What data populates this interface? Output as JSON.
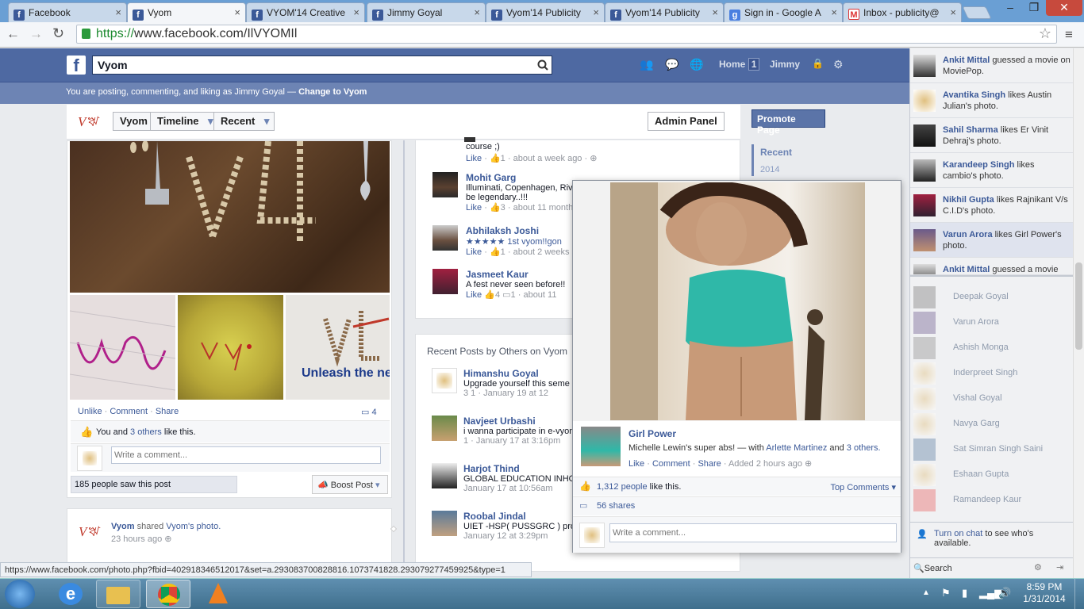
{
  "browser": {
    "tabs": [
      "Facebook",
      "Vyom",
      "VYOM'14 Creative",
      "Jimmy Goyal",
      "Vyom'14 Publicity",
      "Vyom'14 Publicity",
      "Sign in - Google A",
      "Inbox - publicity@"
    ],
    "url_scheme": "https://",
    "url_rest": "www.facebook.com/IlVYOMIl",
    "status_url": "https://www.facebook.com/photo.php?fbid=402918346512017&set=a.293083700828816.1073741828.293079277459925&type=1"
  },
  "header": {
    "search_value": "Vyom",
    "home_label": "Home",
    "home_count": "1",
    "user_name": "Jimmy",
    "posting_as_text": "You are posting, commenting, and liking as Jimmy Goyal — ",
    "change_link": "Change to Vyom"
  },
  "pagebar": {
    "vyom_button": "Vyom",
    "timeline_button": "Timeline",
    "recent_button": "Recent",
    "admin_panel_button": "Admin Panel",
    "promote_page": "Promote Page"
  },
  "left_post": {
    "actions": [
      "Unlike",
      "Comment",
      "Share"
    ],
    "comment_count": "4",
    "likes_prefix": "You and ",
    "likes_link": "3 others",
    "likes_suffix": " like this.",
    "comment_placeholder": "Write a comment...",
    "seen_text": "185 people saw this post",
    "boost_label": "Boost Post",
    "photo3_caption": "Unleash the ne"
  },
  "shared_post": {
    "name": "Vyom",
    "text": " shared ",
    "link": "Vyom's photo.",
    "time": "23 hours ago"
  },
  "comments": [
    {
      "name": "",
      "text": "course ;)",
      "likes": "1",
      "time": "about a week ago"
    },
    {
      "name": "Mohit Garg",
      "text": "Illuminati, Copenhagen, Rivaya",
      "text2": "be legendary..!!!",
      "likes": "3",
      "time": "about 11 month"
    },
    {
      "name": "Abhilaksh Joshi",
      "text": "★★★★★ 1st vyom!!gon",
      "likes": "1",
      "time": "about 2 weeks"
    },
    {
      "name": "Jasmeet Kaur",
      "text": "A fest never seen before!!",
      "likes": "4",
      "comments": "1",
      "time": "about 11"
    }
  ],
  "recent_others": {
    "heading": "Recent Posts by Others on Vyom",
    "posts": [
      {
        "name": "Himanshu Goyal",
        "text": "Upgrade yourself this seme",
        "meta": "3   1 · January 19 at 12"
      },
      {
        "name": "Navjeet Urbashi",
        "text": "i wanna participate in e-vyom",
        "meta": "1 · January 17 at 3:16pm"
      },
      {
        "name": "Harjot Thind",
        "text": "GLOBAL EDUCATION INHOUS",
        "meta": "January 17 at 10:56am"
      },
      {
        "name": "Roobal Jindal",
        "text": "UIET -HSP( PUSSGRC ) proud",
        "meta": "January 12 at 3:29pm"
      }
    ]
  },
  "timeline_nav": {
    "recent": "Recent",
    "year": "2014"
  },
  "popup": {
    "page_name": "Girl Power",
    "caption_prefix": "Michelle Lewin's super abs! — with ",
    "tagged": "Arlette Martinez",
    "and": " and ",
    "others": "3 others.",
    "actions": [
      "Like",
      "Comment",
      "Share"
    ],
    "added": "Added 2 hours ago",
    "likes_link": "1,312 people",
    "likes_suffix": " like this.",
    "top_comments": "Top Comments ▾",
    "shares": "56 shares",
    "comment_placeholder": "Write a comment..."
  },
  "ticker": [
    {
      "name": "Ankit Mittal",
      "text": " guessed a movie on MoviePop."
    },
    {
      "name": "Avantika Singh",
      "text": " likes Austin Julian's photo."
    },
    {
      "name": "Sahil Sharma",
      "text": " likes Er Vinit Dehraj's photo."
    },
    {
      "name": "Karandeep Singh",
      "text": " likes cambio's photo."
    },
    {
      "name": "Nikhil Gupta",
      "text": " likes Rajnikant V/s C.I.D's photo."
    },
    {
      "name": "Varun Arora",
      "text": " likes Girl Power's photo."
    },
    {
      "name": "Ankit Mittal",
      "text": " guessed a movie"
    }
  ],
  "friends": [
    "Deepak Goyal",
    "Varun Arora",
    "Ashish Monga",
    "Inderpreet Singh",
    "Vishal Goyal",
    "Navya Garg",
    "Sat Simran Singh Saini",
    "Eshaan Gupta",
    "Ramandeep Kaur"
  ],
  "chat": {
    "turn_on": "Turn on chat",
    "rest": " to see who's available.",
    "search": "Search"
  },
  "taskbar": {
    "time": "8:59 PM",
    "date": "1/31/2014"
  }
}
